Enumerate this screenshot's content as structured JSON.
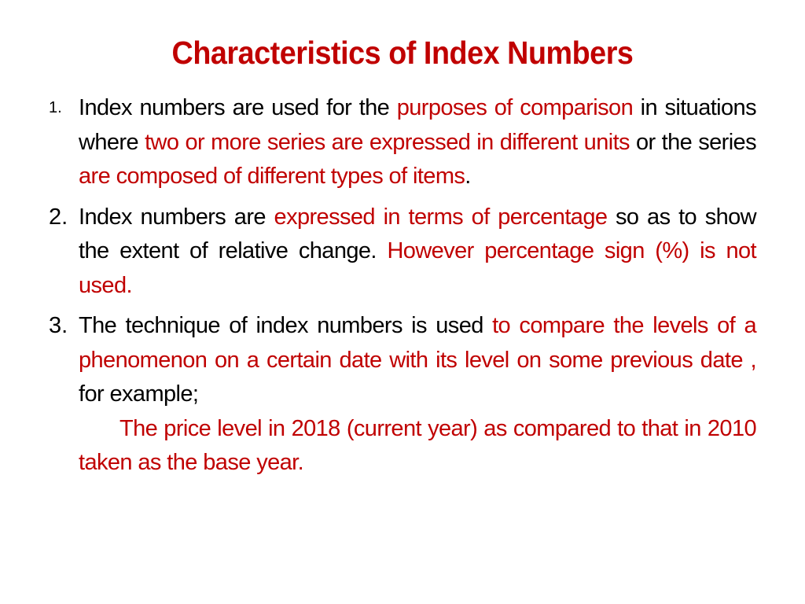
{
  "slide": {
    "title": "Characteristics of Index Numbers",
    "accent_color": "#c00000",
    "items": [
      {
        "number": "1.",
        "segments": [
          {
            "text": "Index numbers are used for the ",
            "color": "black"
          },
          {
            "text": "purposes of comparison",
            "color": "red"
          },
          {
            "text": " in situations where ",
            "color": "black"
          },
          {
            "text": "two or more series are expressed in different units",
            "color": "red"
          },
          {
            "text": " or the series ",
            "color": "black"
          },
          {
            "text": "are composed of different types of items",
            "color": "red"
          },
          {
            "text": ".",
            "color": "black"
          }
        ]
      },
      {
        "number": "2.",
        "segments": [
          {
            "text": "Index numbers are ",
            "color": "black"
          },
          {
            "text": "expressed in terms of percentage",
            "color": "red"
          },
          {
            "text": " so as to show the extent of relative change. ",
            "color": "black"
          },
          {
            "text": "However percentage sign (%) is not used.",
            "color": "red"
          }
        ]
      },
      {
        "number": "3.",
        "segments": [
          {
            "text": "The technique of index numbers is used ",
            "color": "black"
          },
          {
            "text": "to compare the levels of a phenomenon on a certain date with its level on some previous date ,",
            "color": "red"
          },
          {
            "text": " for example;",
            "color": "black"
          }
        ],
        "example": "The price level in 2018 (current year) as compared to that in 2010 taken as the base year."
      }
    ]
  }
}
